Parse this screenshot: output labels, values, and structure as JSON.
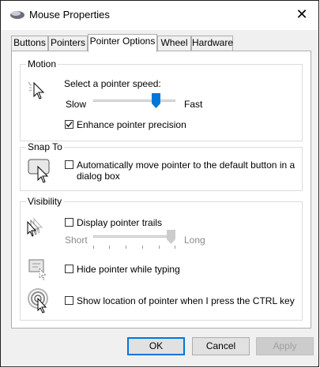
{
  "window": {
    "title": "Mouse Properties",
    "close_glyph": "✕"
  },
  "tabs": [
    {
      "label": "Buttons"
    },
    {
      "label": "Pointers"
    },
    {
      "label": "Pointer Options",
      "active": true
    },
    {
      "label": "Wheel"
    },
    {
      "label": "Hardware"
    }
  ],
  "motion": {
    "group_title": "Motion",
    "speed_label": "Select a pointer speed:",
    "slow_label": "Slow",
    "fast_label": "Fast",
    "speed_fraction": 0.8,
    "precision_label": "Enhance pointer precision",
    "precision_checked": true
  },
  "snap": {
    "group_title": "Snap To",
    "label_line1": "Automatically move pointer to the default button in a",
    "label_line2": "dialog box",
    "checked": false
  },
  "visibility": {
    "group_title": "Visibility",
    "trails_label": "Display pointer trails",
    "trails_checked": false,
    "short_label": "Short",
    "long_label": "Long",
    "trails_fraction": 1.0,
    "hide_label": "Hide pointer while typing",
    "hide_checked": false,
    "show_location_label": "Show location of pointer when I press the CTRL key",
    "show_location_checked": false
  },
  "buttons": {
    "ok": "OK",
    "cancel": "Cancel",
    "apply": "Apply"
  },
  "colors": {
    "accent": "#0078d7",
    "disabled_text": "#8a8a8a"
  }
}
